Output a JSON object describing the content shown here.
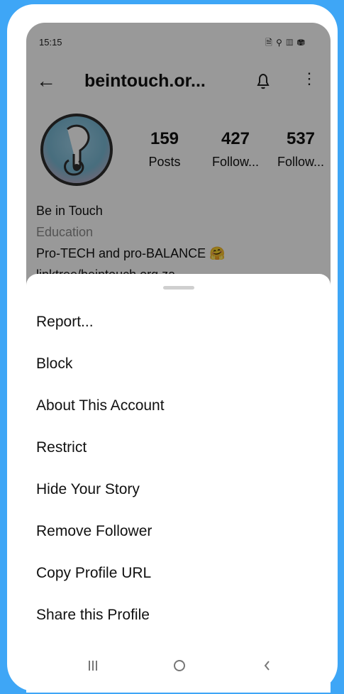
{
  "status_bar": {
    "time": "15:15",
    "icons": "🗎 ⚲ ▥ ⛃"
  },
  "profile": {
    "username": "beintouch.or...",
    "posts_count": "159",
    "posts_label": "Posts",
    "followers_count": "427",
    "followers_label": "Follow...",
    "following_count": "537",
    "following_label": "Follow...",
    "name": "Be in Touch",
    "category": "Education",
    "bio": "Pro-TECH and pro-BALANCE 🤗",
    "link": "linktree/beintouch.org.za"
  },
  "sheet": {
    "items": [
      "Report...",
      "Block",
      "About This Account",
      "Restrict",
      "Hide Your Story",
      "Remove Follower",
      "Copy Profile URL",
      "Share this Profile"
    ]
  },
  "colors": {
    "background": "#3ea6f6",
    "overlay": "rgba(0,0,0,0.40)",
    "sheet": "#ffffff"
  },
  "icons": {
    "back": "arrow-left-icon",
    "notifications": "bell-icon",
    "more": "more-vertical-icon",
    "recent_apps": "recent-apps-icon",
    "home": "home-icon",
    "back_nav": "back-nav-icon"
  }
}
